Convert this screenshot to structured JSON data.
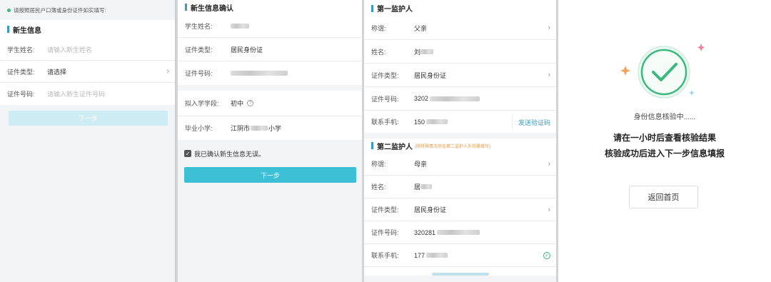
{
  "panel1": {
    "notice": "请按照居民户口簿或身份证件如实填写:",
    "section_title": "新生信息",
    "fields": [
      {
        "label": "学生姓名:",
        "placeholder": "请输入新生姓名"
      },
      {
        "label": "证件类型:",
        "value": "请选择"
      },
      {
        "label": "证件号码:",
        "placeholder": "请输入新生证件号码"
      }
    ],
    "next_label": "下一步"
  },
  "panel2": {
    "section_title": "新生信息确认",
    "fields": [
      {
        "label": "学生姓名:",
        "value": ""
      },
      {
        "label": "证件类型:",
        "value": "居民身份证"
      },
      {
        "label": "证件号码:",
        "value": ""
      }
    ],
    "school_fields": [
      {
        "label": "拟入学学段:",
        "value": "初中"
      },
      {
        "label": "毕业小学:",
        "value_prefix": "江阴市",
        "value_suffix": "小学"
      }
    ],
    "confirm_label": "我已确认新生信息无误。",
    "next_label": "下一步"
  },
  "panel3": {
    "guardian1_title": "第一监护人",
    "guardian1": [
      {
        "label": "称谓:",
        "value": "父亲"
      },
      {
        "label": "姓名:",
        "value": "刘"
      },
      {
        "label": "证件类型:",
        "value": "居民身份证"
      },
      {
        "label": "证件号码:",
        "value": "3202"
      },
      {
        "label": "联系手机:",
        "value": "150"
      }
    ],
    "send_code_label": "发送验证码",
    "guardian2_title": "第二监护人",
    "guardian2_note": "(除特殊情况须无第二监护人外均需填写)",
    "guardian2": [
      {
        "label": "称谓:",
        "value": "母亲"
      },
      {
        "label": "姓名:",
        "value": "居"
      },
      {
        "label": "证件类型:",
        "value": "居民身份证"
      },
      {
        "label": "证件号码:",
        "value": "320281"
      },
      {
        "label": "联系手机:",
        "value": "177"
      }
    ]
  },
  "panel4": {
    "status": "身份信息核验中......",
    "line1": "请在一小时后查看核验结果",
    "line2": "核验成功后进入下一步信息填报",
    "home_button": "返回首页"
  },
  "colors": {
    "accent": "#3dbfd6",
    "check": "#3cb880",
    "link": "#3a9bbd",
    "sparkle_orange": "#f5a35a",
    "sparkle_pink": "#ef7e92",
    "sparkle_blue": "#8fd4e8"
  }
}
